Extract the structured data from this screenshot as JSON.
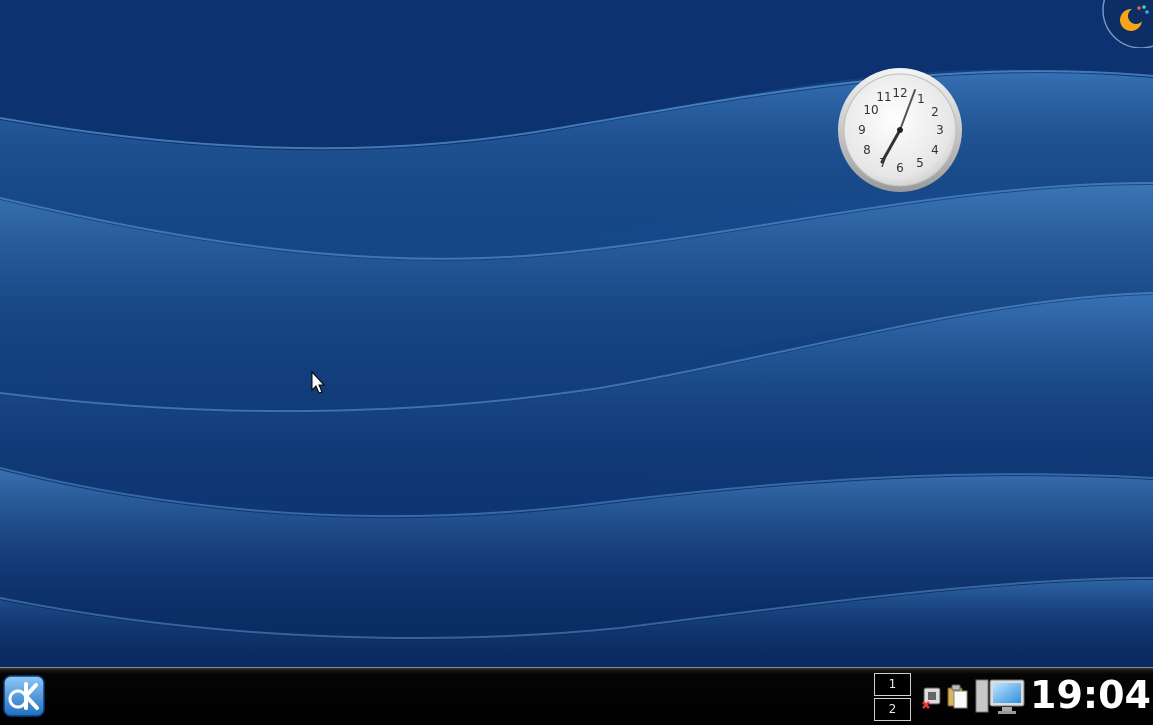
{
  "desktop": {
    "clock_numerals": [
      "12",
      "1",
      "2",
      "3",
      "4",
      "5",
      "6",
      "7",
      "8",
      "9",
      "10",
      "11"
    ]
  },
  "panel": {
    "pager": {
      "desktops": [
        "1",
        "2"
      ]
    },
    "clock_time": "19:04"
  },
  "icons": {
    "launcher": "kde-k-menu-icon",
    "cashew": "plasma-cashew-icon",
    "device_notifier": "device-notifier-icon",
    "clipboard": "clipboard-icon",
    "computer": "computer-monitor-icon"
  },
  "colors": {
    "wallpaper_base": "#123f7d",
    "panel": "#000000",
    "clock_text": "#ffffff"
  }
}
